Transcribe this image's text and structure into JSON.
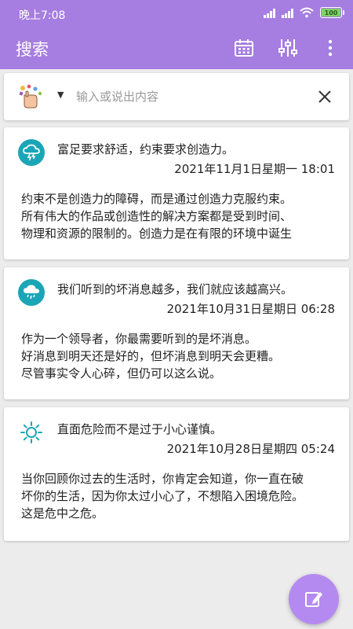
{
  "status_bar": {
    "time": "晚上7:08",
    "battery": "100"
  },
  "app_bar": {
    "title": "搜索",
    "icons": [
      "calendar-icon",
      "equalizer-icon",
      "more-vert-icon"
    ]
  },
  "search": {
    "placeholder": "输入或说出内容",
    "value": ""
  },
  "notes": [
    {
      "icon": "thunderstorm-icon",
      "title": "富足要求舒适，约束要求创造力。",
      "date": "2021年11月1日星期一 18:01",
      "body": [
        "约束不是创造力的障碍，而是通过创造力克服约束。",
        "所有伟大的作品或创造性的解决方案都是受到时间、",
        "物理和资源的限制的。创造力是在有限的环境中诞生"
      ]
    },
    {
      "icon": "rain-cloud-icon",
      "title": "我们听到的坏消息越多，我们就应该越高兴。",
      "date": "2021年10月31日星期日 06:28",
      "body": [
        "作为一个领导者，你最需要听到的是坏消息。",
        "好消息到明天还是好的，但坏消息到明天会更糟。",
        "尽管事实令人心碎，但仍可以这么说。"
      ]
    },
    {
      "icon": "sun-icon",
      "title": "直面危险而不是过于小心谨慎。",
      "date": "2021年10月28日星期四 05:24",
      "body": [
        "当你回顾你过去的生活时，你肯定会知道，你一直在破",
        "坏你的生活，因为你太过小心了，不想陷入困境危险。",
        "这是危中之危。"
      ]
    }
  ],
  "fab": {
    "icon": "edit-icon"
  },
  "colors": {
    "primary": "#a67de0",
    "fab": "#b58af0",
    "weather_icon": "#1aa6b7",
    "background": "#ececec"
  }
}
